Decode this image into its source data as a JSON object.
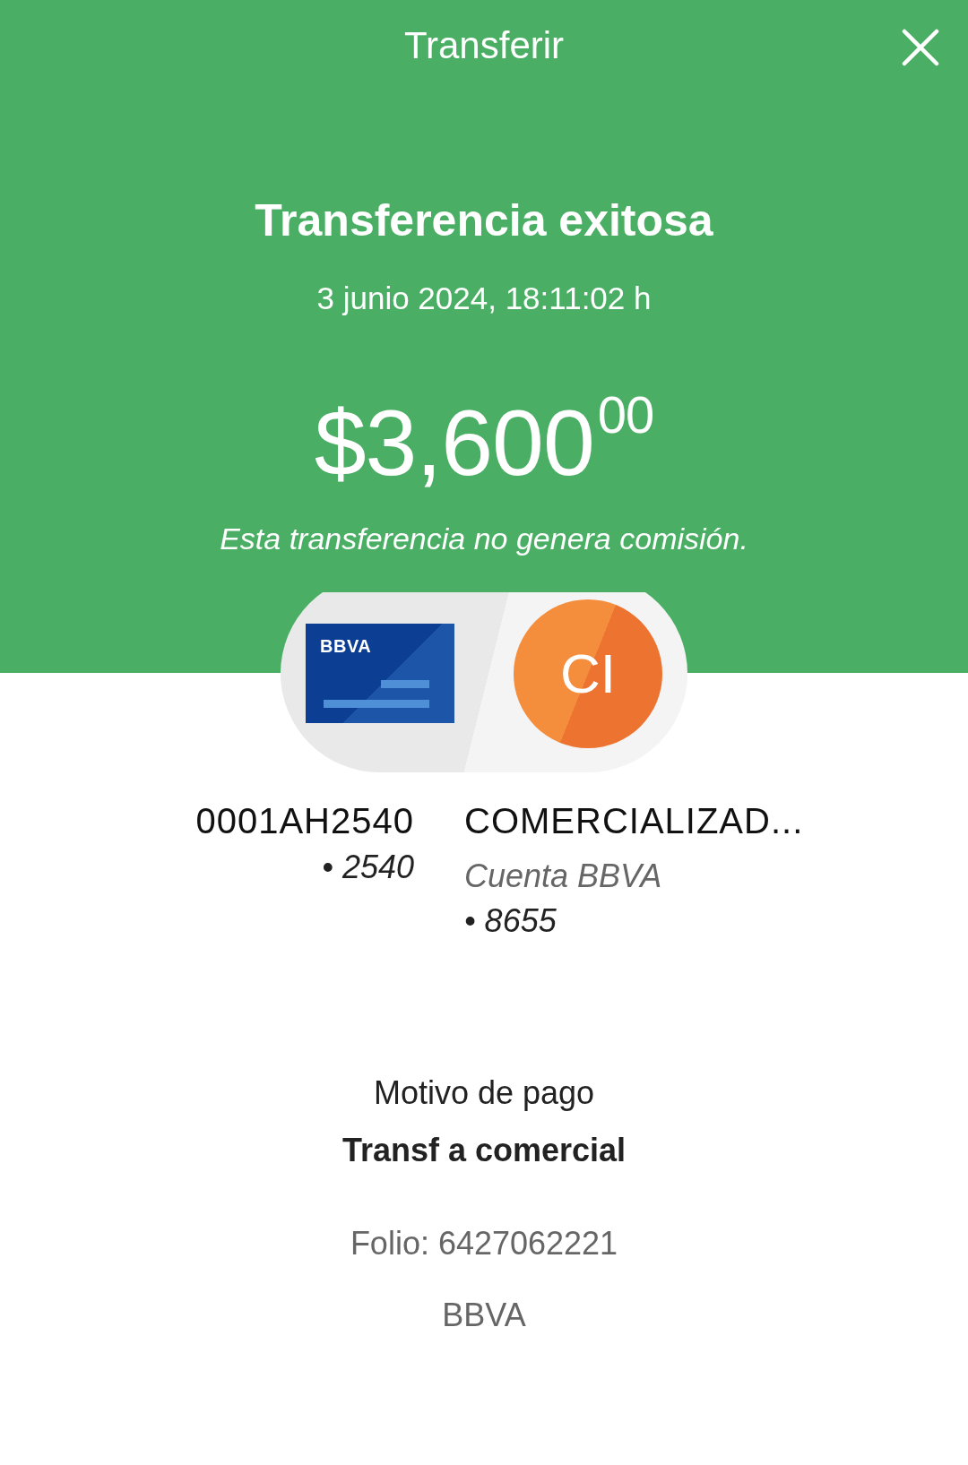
{
  "header": {
    "title": "Transferir"
  },
  "result": {
    "title": "Transferencia exitosa",
    "datetime": "3 junio 2024, 18:11:02 h",
    "amount": "$3,600$^{00}$",
    "note": "Esta transferencia no genera comisión."
  },
  "origin": {
    "card_brand": "BBVA",
    "name": "0001AH2540",
    "detail": "• 2540"
  },
  "destination": {
    "initials": "CI",
    "name": "COMERCIALIZAD...",
    "account_type": "Cuenta BBVA",
    "detail": "• 8655"
  },
  "payment_reason": {
    "label": "Motivo de pago",
    "value": "Transf a comercial"
  },
  "folio": "Folio: 6427062221",
  "bank": "BBVA"
}
